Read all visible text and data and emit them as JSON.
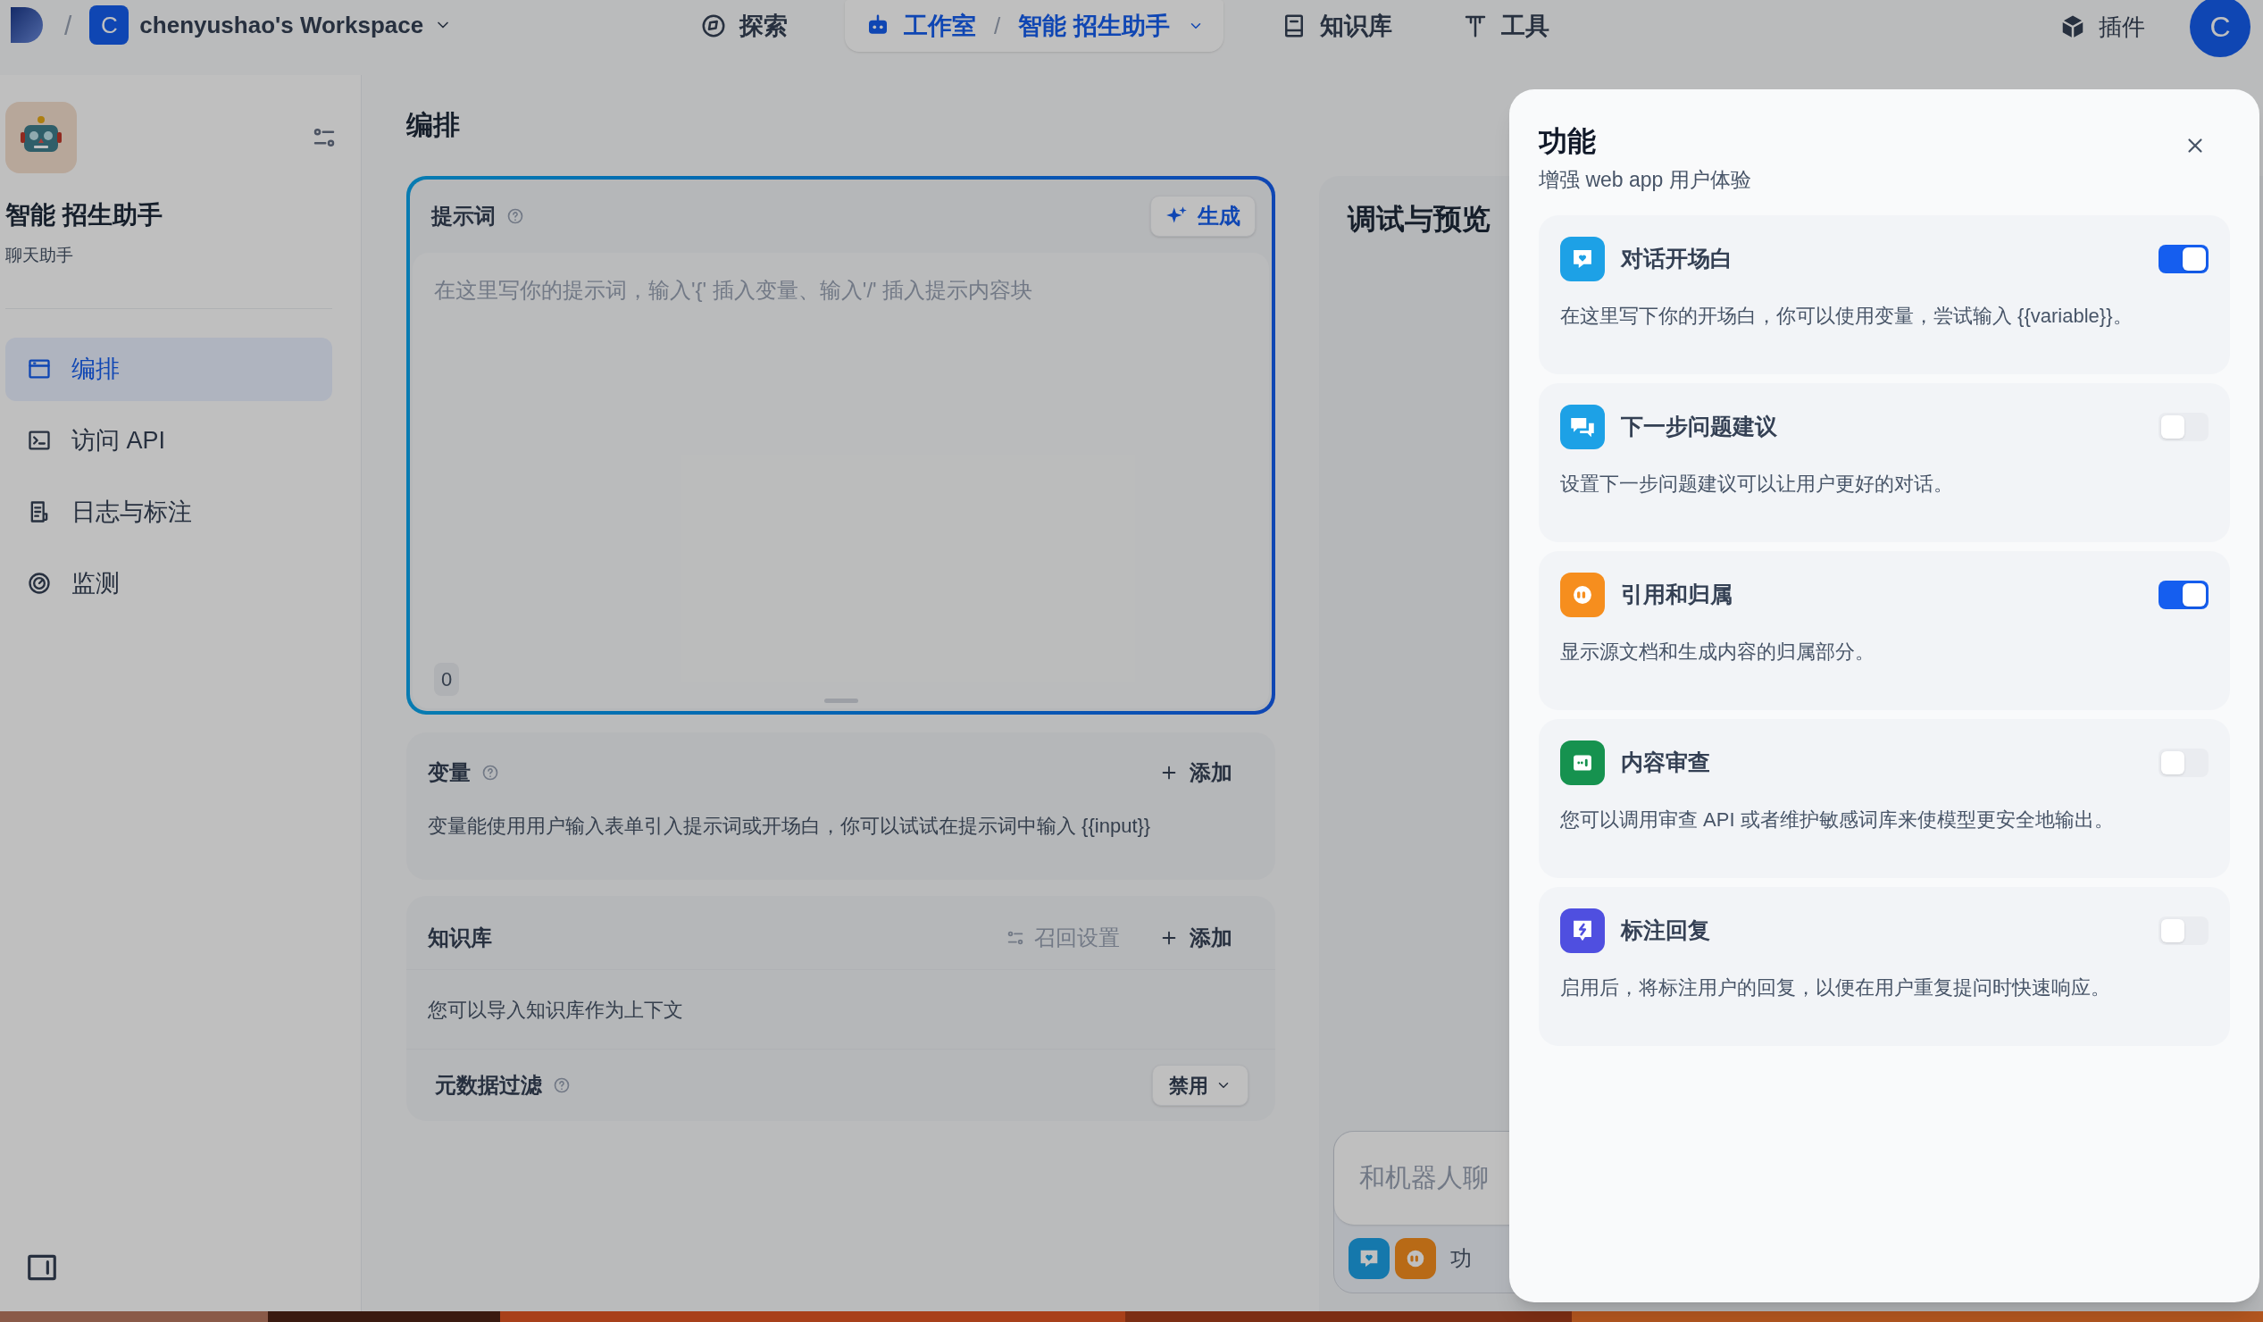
{
  "top_bar": {
    "separator": "/",
    "workspace": {
      "initial": "C",
      "name": "chenyushao's Workspace"
    },
    "nav": [
      {
        "label": "探索",
        "selected": false
      },
      {
        "label": "工作室",
        "selected": true,
        "separator": "/",
        "app": "智能 招生助手"
      },
      {
        "label": "知识库",
        "selected": false
      },
      {
        "label": "工具",
        "selected": false
      }
    ],
    "plugins": "插件",
    "avatar": "C"
  },
  "sidebar": {
    "app_name": "智能 招生助手",
    "app_type": "聊天助手",
    "menu": [
      {
        "label": "编排",
        "selected": true
      },
      {
        "label": "访问 API",
        "selected": false
      },
      {
        "label": "日志与标注",
        "selected": false
      },
      {
        "label": "监测",
        "selected": false
      }
    ]
  },
  "orchestrate": {
    "heading": "编排",
    "prompt": {
      "title": "提示词",
      "generate": "生成",
      "placeholder": "在这里写你的提示词，输入'{' 插入变量、输入'/' 插入提示内容块",
      "count": "0"
    },
    "variables": {
      "title": "变量",
      "add": "添加",
      "description": "变量能使用用户输入表单引入提示词或开场白，你可以试试在提示词中输入 {{input}}"
    },
    "knowledge": {
      "title": "知识库",
      "recall_settings": "召回设置",
      "add": "添加",
      "description": "您可以导入知识库作为上下文",
      "metadata_filter": {
        "label": "元数据过滤",
        "value": "禁用"
      }
    }
  },
  "debug": {
    "title": "调试与预览",
    "chat_placeholder": "和机器人聊",
    "features_label": "功"
  },
  "features_dialog": {
    "title": "功能",
    "subtitle": "增强 web app 用户体验",
    "features": [
      {
        "title": "对话开场白",
        "description": "在这里写下你的开场白，你可以使用变量，尝试输入 {{variable}}。",
        "on": true,
        "color": "#1da1e6"
      },
      {
        "title": "下一步问题建议",
        "description": "设置下一步问题建议可以让用户更好的对话。",
        "on": false,
        "color": "#1da1e6"
      },
      {
        "title": "引用和归属",
        "description": "显示源文档和生成内容的归属部分。",
        "on": true,
        "color": "#f68e1e"
      },
      {
        "title": "内容审查",
        "description": "您可以调用审查 API 或者维护敏感词库来使模型更安全地输出。",
        "on": false,
        "color": "#16924f"
      },
      {
        "title": "标注回复",
        "description": "启用后，将标注用户的回复，以便在用户重复提问时快速响应。",
        "on": false,
        "color": "#4f4fe0"
      }
    ]
  }
}
